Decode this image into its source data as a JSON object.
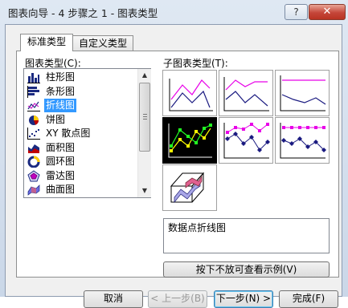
{
  "window": {
    "title": "图表向导 - 4 步骤之 1 - 图表类型",
    "help_glyph": "?",
    "close_glyph": "✕"
  },
  "tabs": [
    {
      "label": "标准类型",
      "active": true
    },
    {
      "label": "自定义类型",
      "active": false
    }
  ],
  "chart_types": {
    "label": "图表类型(C):",
    "items": [
      {
        "label": "柱形图",
        "icon": "column-chart-icon"
      },
      {
        "label": "条形图",
        "icon": "bar-chart-icon"
      },
      {
        "label": "折线图",
        "icon": "line-chart-icon",
        "selected": true
      },
      {
        "label": "饼图",
        "icon": "pie-chart-icon"
      },
      {
        "label": "XY 散点图",
        "icon": "scatter-chart-icon"
      },
      {
        "label": "面积图",
        "icon": "area-chart-icon"
      },
      {
        "label": "圆环图",
        "icon": "doughnut-chart-icon"
      },
      {
        "label": "雷达图",
        "icon": "radar-chart-icon"
      },
      {
        "label": "曲面图",
        "icon": "surface-chart-icon"
      }
    ]
  },
  "subtypes": {
    "label": "子图表类型(T):",
    "selected_index": 3,
    "description": "数据点折线图"
  },
  "preview_button": "按下不放可查看示例(V)",
  "footer_buttons": [
    {
      "label": "取消",
      "state": "enabled"
    },
    {
      "label": "< 上一步(B)",
      "state": "disabled"
    },
    {
      "label": "下一步(N) >",
      "state": "default"
    },
    {
      "label": "完成(F)",
      "state": "enabled"
    }
  ],
  "colors": {
    "selection": "#3399ff",
    "line_magenta": "#e800e8",
    "line_navy": "#1a1a80",
    "selected_green": "#22ff22",
    "selected_yellow": "#ffff00"
  }
}
